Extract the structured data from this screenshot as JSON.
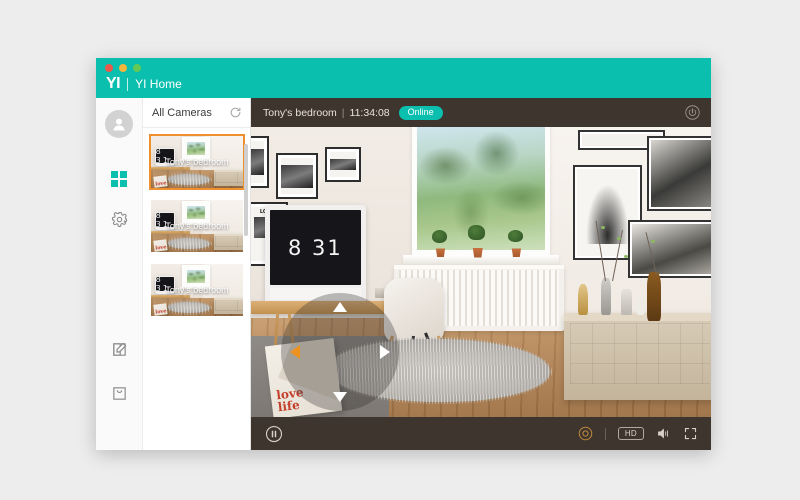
{
  "window": {
    "traffic_lights": [
      {
        "name": "close",
        "color": "#e9584c"
      },
      {
        "name": "minimize",
        "color": "#f2b63c"
      },
      {
        "name": "zoom",
        "color": "#63c954"
      }
    ],
    "brand_logo": "YI",
    "app_title": "YI Home",
    "header_color": "#0bbfae"
  },
  "rail": {
    "avatar": "user-avatar",
    "items": [
      {
        "name": "cameras",
        "icon": "grid-icon",
        "active": true
      },
      {
        "name": "settings",
        "icon": "gear-icon",
        "active": false
      }
    ],
    "bottom_items": [
      {
        "name": "compose",
        "icon": "edit-square-icon"
      },
      {
        "name": "store",
        "icon": "shopping-bag-icon"
      }
    ]
  },
  "camera_list": {
    "title": "All Cameras",
    "refresh_icon": "refresh-icon",
    "cameras": [
      {
        "label": "Tony's bedroom",
        "selected": true
      },
      {
        "label": "Tony's bedroom",
        "selected": false
      },
      {
        "label": "Tony's bedroom",
        "selected": false
      }
    ],
    "selection_color": "#ef9030"
  },
  "player": {
    "camera_name": "Tony's bedroom",
    "separator": "|",
    "timestamp": "11:34:08",
    "status_badge": "Online",
    "status_color": "#0bbfae",
    "power_icon": "power-icon",
    "panel_color": "#3e352e"
  },
  "ptz": {
    "up": "arrow-up",
    "down": "arrow-down",
    "left": "arrow-left",
    "right": "arrow-right",
    "active_direction": "left",
    "active_color": "#f0921f"
  },
  "controls": {
    "pause": "pause-icon",
    "record": "record-icon",
    "record_color": "#c08a3e",
    "quality_label": "HD",
    "speaker": "speaker-icon",
    "fullscreen": "fullscreen-icon"
  },
  "scene": {
    "monitor_clock": "8 31",
    "poster_line1": "love",
    "poster_line2": "life"
  }
}
